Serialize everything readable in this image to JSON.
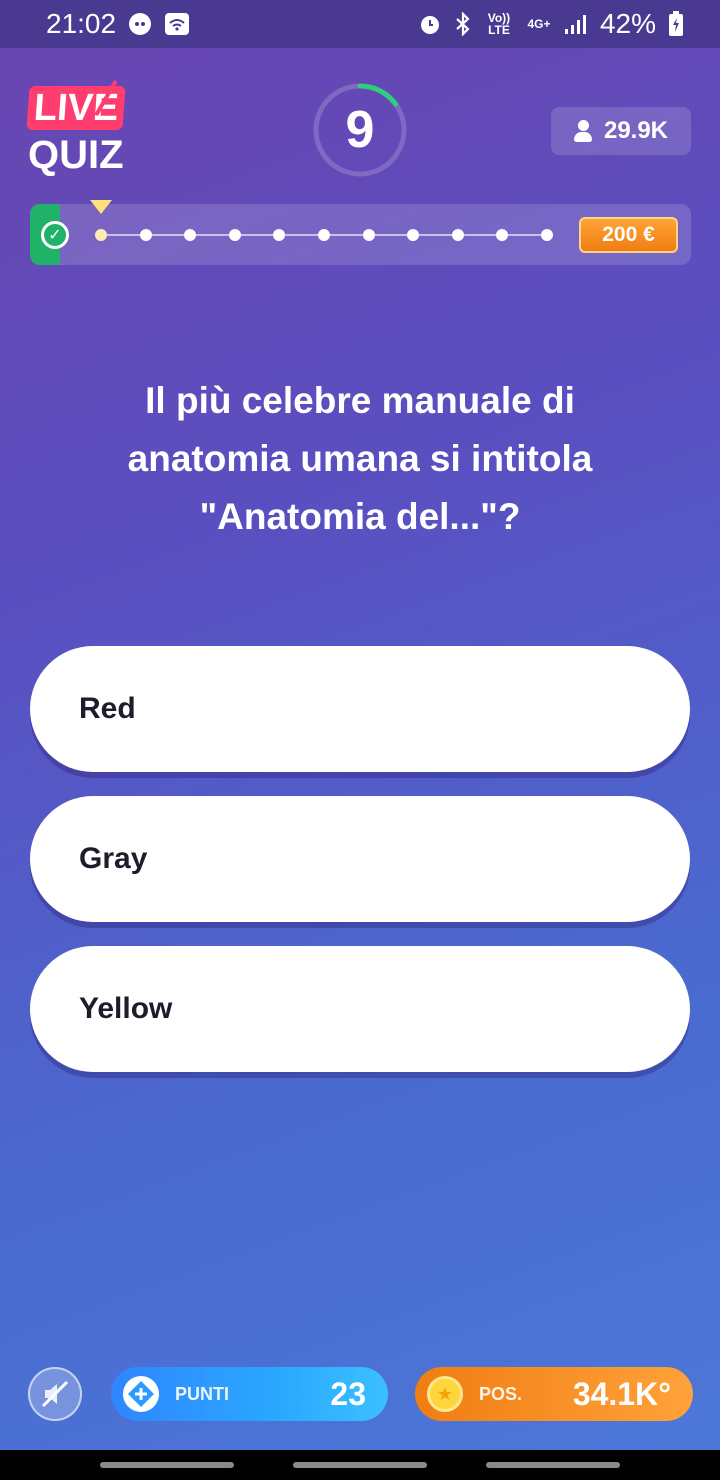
{
  "status_bar": {
    "time": "21:02",
    "network_volte": "Vo)) LTE",
    "network_4g": "4G+",
    "battery": "42%"
  },
  "header": {
    "logo_live": "LIVE",
    "logo_quiz": "QUIZ",
    "timer_value": "9",
    "timer_progress": 0.15,
    "players_count": "29.9K"
  },
  "progress": {
    "total_questions": 12,
    "current_question": 2,
    "prize": "200 €"
  },
  "question": {
    "text": "Il più celebre manuale di anatomia umana si intitola \"Anatomia del...\"?"
  },
  "answers": [
    {
      "label": "Red"
    },
    {
      "label": "Gray"
    },
    {
      "label": "Yellow"
    }
  ],
  "footer": {
    "points_label": "PUNTI",
    "points_value": "23",
    "position_label": "POS.",
    "position_value": "34.1K°"
  },
  "colors": {
    "accent_pink": "#ff3d6e",
    "timer_green": "#2ad07c",
    "prize_orange": "#f07e12",
    "points_blue": "#2f86ff"
  },
  "icons": {
    "mute": "speaker-muted-icon",
    "points": "diamond-plus-icon",
    "position": "medal-star-icon"
  }
}
